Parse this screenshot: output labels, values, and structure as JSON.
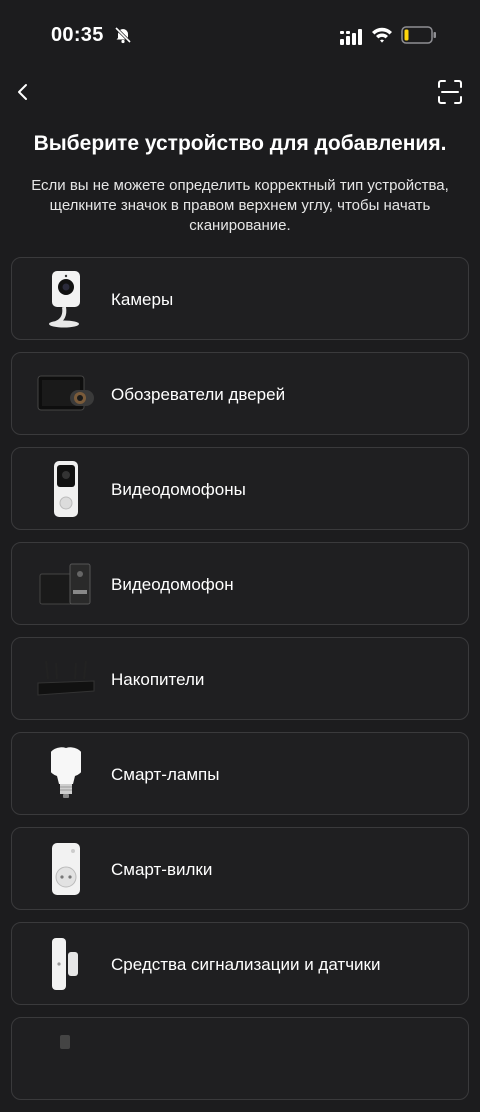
{
  "status_bar": {
    "time": "00:35"
  },
  "header": {
    "title": "Выберите устройство для добавления.",
    "subtitle": "Если вы не можете определить корректный тип устройства, щелкните значок в правом верхнем углу, чтобы начать сканирование."
  },
  "devices": [
    {
      "label": "Камеры",
      "icon": "camera-icon"
    },
    {
      "label": "Обозреватели дверей",
      "icon": "door-viewer-icon"
    },
    {
      "label": "Видеодомофоны",
      "icon": "video-doorbell-icon"
    },
    {
      "label": "Видеодомофон",
      "icon": "video-intercom-icon"
    },
    {
      "label": "Накопители",
      "icon": "nvr-recorder-icon"
    },
    {
      "label": "Смарт-лампы",
      "icon": "smart-bulb-icon"
    },
    {
      "label": "Смарт-вилки",
      "icon": "smart-plug-icon"
    },
    {
      "label": "Средства сигнализации и датчики",
      "icon": "door-sensor-icon"
    }
  ],
  "colors": {
    "background": "#1c1c1e",
    "card_border": "#3a3a3c",
    "battery_low": "#ffd60a"
  }
}
